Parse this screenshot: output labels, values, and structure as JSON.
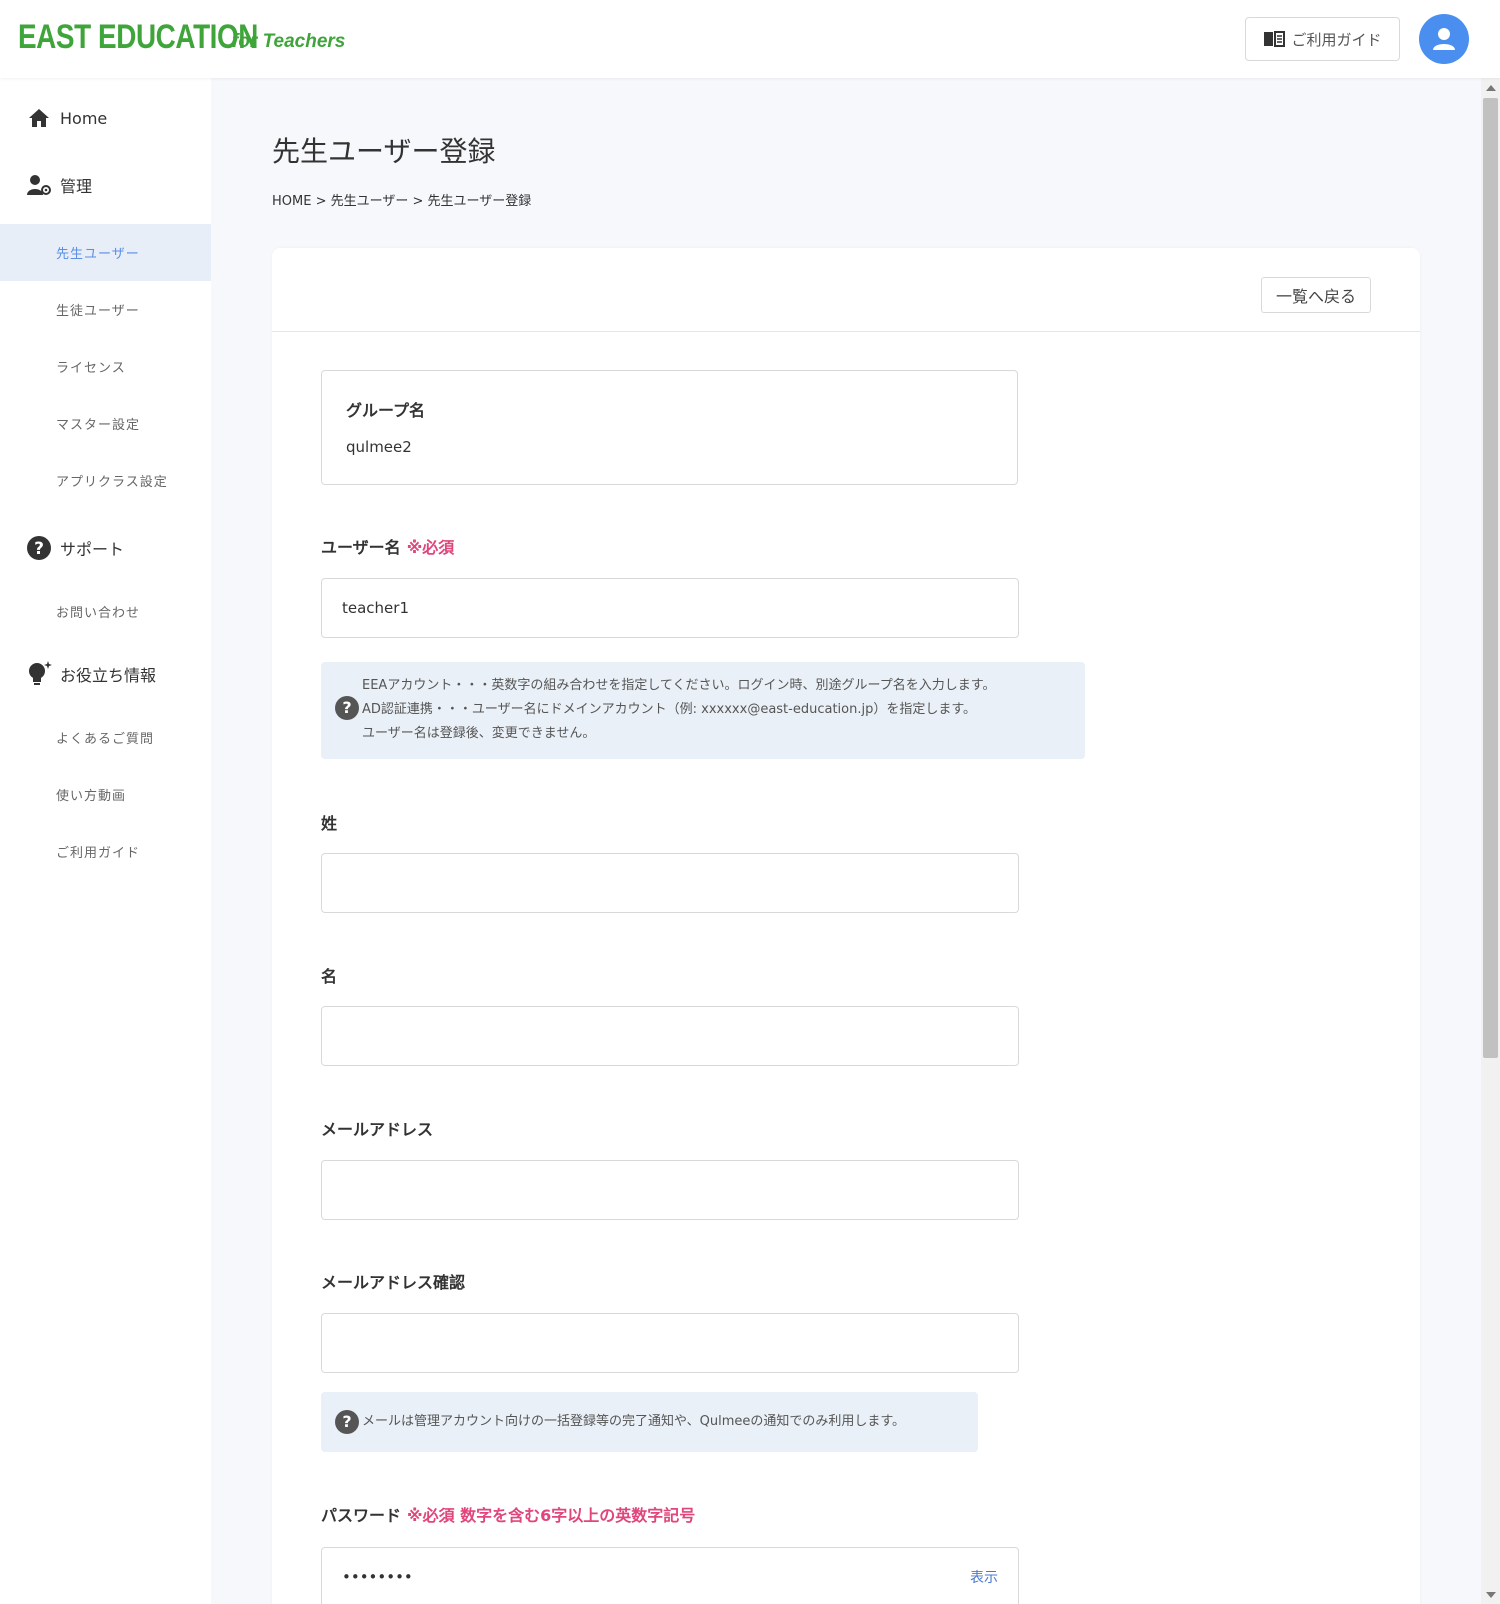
{
  "header": {
    "logo": "EAST EDUCATION",
    "logo_sub": "for Teachers",
    "guide_label": "ご利用ガイド"
  },
  "sidebar": {
    "home": "Home",
    "manage": "管理",
    "manage_items": [
      "先生ユーザー",
      "生徒ユーザー",
      "ライセンス",
      "マスター設定",
      "アプリクラス設定"
    ],
    "support": "サポート",
    "support_items": [
      "お問い合わせ"
    ],
    "info": "お役立ち情報",
    "info_items": [
      "よくあるご質問",
      "使い方動画",
      "ご利用ガイド"
    ]
  },
  "main": {
    "title": "先生ユーザー登録",
    "breadcrumb": [
      "HOME",
      "先生ユーザー",
      "先生ユーザー登録"
    ],
    "back_button": "一覧へ戻る",
    "group": {
      "label": "グループ名",
      "value": "qulmee2"
    },
    "username": {
      "label": "ユーザー名",
      "required": "※必須",
      "value": "teacher1",
      "hint": [
        "EEAアカウント・・・英数字の組み合わせを指定してください。ログイン時、別途グループ名を入力します。",
        "AD認証連携・・・ユーザー名にドメインアカウント（例: xxxxxx@east-education.jp）を指定します。",
        "ユーザー名は登録後、変更できません。"
      ]
    },
    "last_name": {
      "label": "姓",
      "value": ""
    },
    "first_name": {
      "label": "名",
      "value": ""
    },
    "email": {
      "label": "メールアドレス",
      "value": ""
    },
    "email_confirm": {
      "label": "メールアドレス確認",
      "value": "",
      "hint": "メールは管理アカウント向けの一括登録等の完了通知や、Qulmeeの通知でのみ利用します。"
    },
    "password": {
      "label": "パスワード",
      "required": "※必須 数字を含む6字以上の英数字記号",
      "value": "••••••••",
      "show_label": "表示"
    }
  },
  "colors": {
    "brand_green": "#3fa53a",
    "accent_blue": "#4a8ef0",
    "required_pink": "#e0457b",
    "active_nav_bg": "#e8eef8"
  }
}
